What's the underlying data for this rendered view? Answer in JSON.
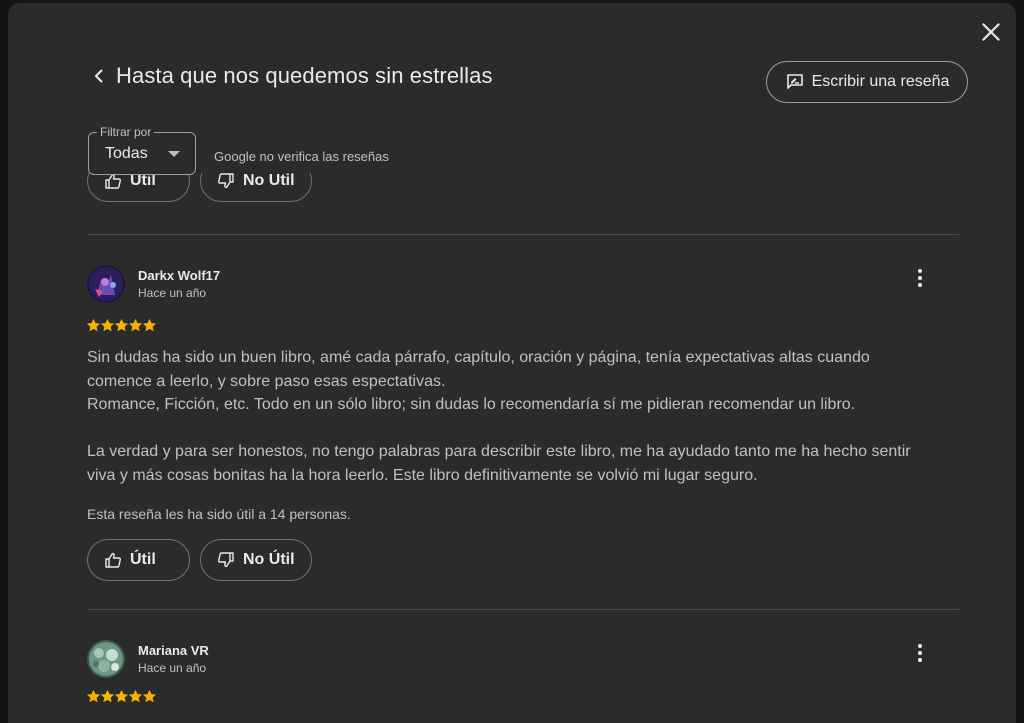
{
  "dialog": {
    "title": "Hasta que nos quedemos sin estrellas",
    "write_review_label": "Escribir una reseña"
  },
  "filter": {
    "legend": "Filtrar por",
    "value": "Todas",
    "note": "Google no verifica las reseñas"
  },
  "previous_review": {
    "helpful_label": "Útil",
    "not_helpful_label": "No Útil"
  },
  "reviews": [
    {
      "name": "Darkx Wolf17",
      "date": "Hace un año",
      "rating": 5,
      "text": "Sin dudas ha sido un buen libro, amé cada párrafo, capítulo, oración y página, tenía expectativas altas cuando comence a leerlo, y sobre paso esas espectativas.\nRomance, Ficción, etc. Todo en un sólo libro; sin dudas lo recomendaría sí me pidieran recomendar un libro.\n\nLa verdad y para ser honestos, no tengo palabras para describir este libro, me ha ayudado tanto me ha hecho sentir viva y más cosas bonitas ha la hora leerlo. Este libro definitivamente se volvió mi lugar seguro.",
      "helpful_count_text": "Esta reseña les ha sido útil a 14 personas.",
      "helpful_label": "Útil",
      "not_helpful_label": "No Útil"
    },
    {
      "name": "Mariana VR",
      "date": "Hace un año",
      "rating": 5
    }
  ],
  "colors": {
    "background": "#2b2b2b",
    "star": "#f4b400",
    "text_primary": "#e8eaed",
    "text_secondary": "#bdc1c6"
  }
}
